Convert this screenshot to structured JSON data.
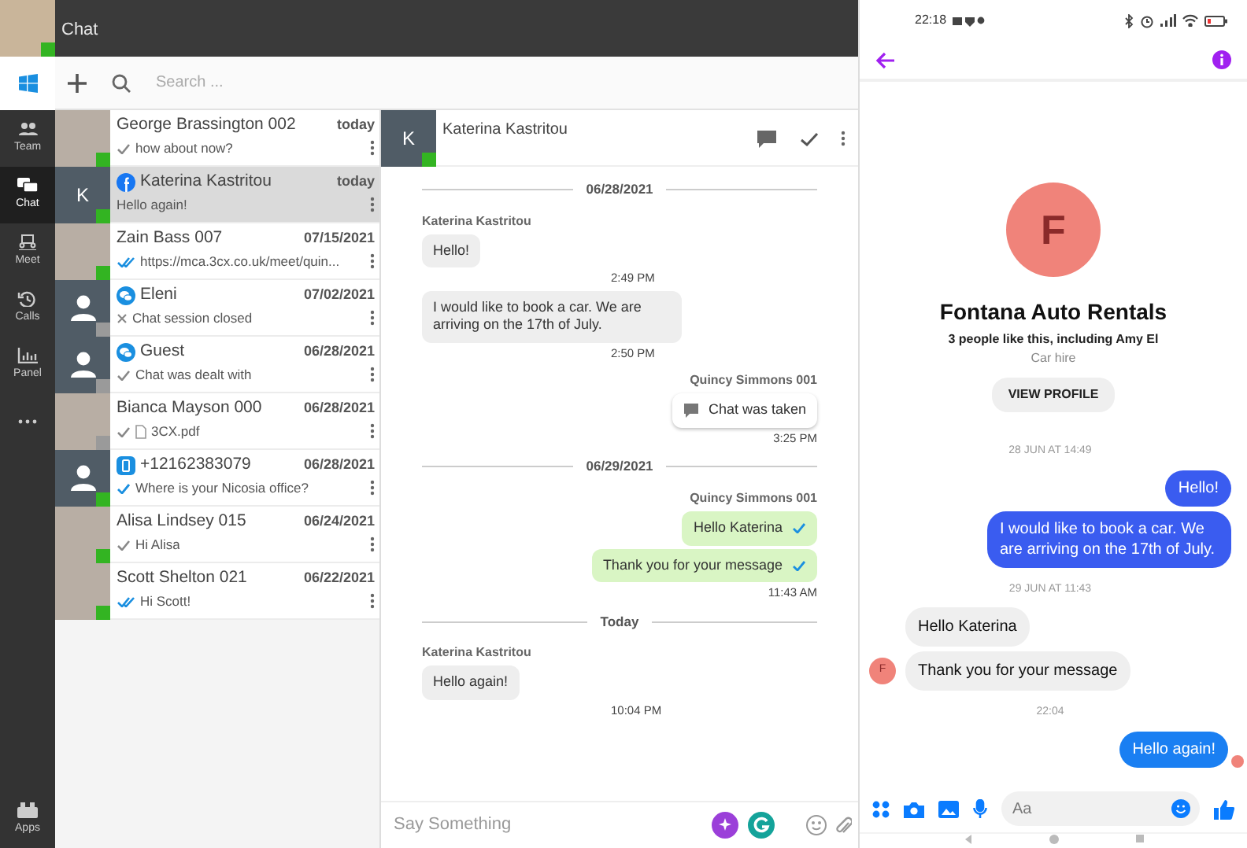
{
  "app": {
    "title": "Chat",
    "search": {
      "placeholder": "Search ..."
    },
    "user_presence": {
      "color": "#33b422"
    }
  },
  "rail": [
    {
      "label": "Team",
      "kind": "team",
      "selected": false
    },
    {
      "label": "Chat",
      "kind": "chat",
      "selected": true
    },
    {
      "label": "Meet",
      "kind": "meet",
      "selected": false
    },
    {
      "label": "Calls",
      "kind": "calls",
      "selected": false
    },
    {
      "label": "Panel",
      "kind": "panel",
      "selected": false
    },
    {
      "kind": "more",
      "selected": false
    }
  ],
  "rail_bottom": {
    "label": "Apps"
  },
  "contacts": [
    {
      "name": "George Brassington 002",
      "time": "today",
      "preview": "how about now?",
      "avatar": {
        "kind": "photo"
      },
      "tick": {
        "kind": "check"
      },
      "attachment": false,
      "color": "#33b422",
      "selected": false
    },
    {
      "name": "Katerina Kastritou",
      "time": "today",
      "preview": "Hello again!",
      "avatar": {
        "kind": "letter",
        "initial": "K"
      },
      "channel": {
        "kind": "facebook"
      },
      "attachment": false,
      "color": "#33b422",
      "selected": true
    },
    {
      "name": "Zain Bass 007",
      "time": "07/15/2021",
      "preview": "https://mca.3cx.co.uk/meet/quin...",
      "avatar": {
        "kind": "photo"
      },
      "tick": {
        "kind": "double"
      },
      "attachment": false,
      "color": "#33b422",
      "selected": false
    },
    {
      "name": "Eleni",
      "time": "07/02/2021",
      "preview": "Chat session closed",
      "avatar": {
        "kind": "silhouette"
      },
      "channel": {
        "kind": "webchat"
      },
      "tick": {
        "kind": "cross"
      },
      "attachment": false,
      "color": "#9a9a9a",
      "selected": false
    },
    {
      "name": "Guest",
      "time": "06/28/2021",
      "preview": "Chat was dealt with",
      "avatar": {
        "kind": "silhouette"
      },
      "channel": {
        "kind": "webchat"
      },
      "tick": {
        "kind": "check"
      },
      "attachment": false,
      "color": "#9a9a9a",
      "selected": false
    },
    {
      "name": "Bianca Mayson 000",
      "time": "06/28/2021",
      "preview": "3CX.pdf",
      "avatar": {
        "kind": "photo"
      },
      "tick": {
        "kind": "check"
      },
      "attachment": true,
      "color": "#9a9a9a",
      "selected": false
    },
    {
      "name": "+12162383079",
      "time": "06/28/2021",
      "preview": "Where is your Nicosia office?",
      "avatar": {
        "kind": "silhouette"
      },
      "channel": {
        "kind": "phone"
      },
      "tick": {
        "kind": "check-blue"
      },
      "attachment": false,
      "color": "#33b422",
      "selected": false
    },
    {
      "name": "Alisa Lindsey 015",
      "time": "06/24/2021",
      "preview": "Hi Alisa",
      "avatar": {
        "kind": "photo"
      },
      "tick": {
        "kind": "check"
      },
      "attachment": false,
      "color": "#33b422",
      "selected": false
    },
    {
      "name": "Scott Shelton 021",
      "time": "06/22/2021",
      "preview": "Hi Scott!",
      "avatar": {
        "kind": "photo"
      },
      "tick": {
        "kind": "double"
      },
      "attachment": false,
      "color": "#33b422",
      "selected": false
    }
  ],
  "conversation": {
    "name": "Katerina Kastritou",
    "initial": "K",
    "presence": {
      "color": "#33b422"
    },
    "messages": [
      {
        "kind": "date",
        "text": "06/28/2021"
      },
      {
        "kind": "in",
        "sender": "Katerina Kastritou",
        "text": "Hello!",
        "time": "2:49 PM"
      },
      {
        "kind": "in",
        "text": "I would like to book a car. We are arriving on the 17th of July.",
        "time": "2:50 PM"
      },
      {
        "kind": "system",
        "sender": "Quincy Simmons 001",
        "text": "Chat was taken",
        "time": "3:25 PM"
      },
      {
        "kind": "date",
        "text": "06/29/2021"
      },
      {
        "kind": "out",
        "sender": "Quincy Simmons 001",
        "text": "Hello Katerina",
        "read": true
      },
      {
        "kind": "out",
        "text": "Thank you for your message",
        "read": true,
        "time": "11:43 AM"
      },
      {
        "kind": "date",
        "text": "Today"
      },
      {
        "kind": "in",
        "sender": "Katerina Kastritou",
        "text": "Hello again!",
        "time": "10:04 PM"
      }
    ],
    "composer": {
      "placeholder": "Say Something"
    }
  },
  "phone": {
    "status_bar": {
      "time": "22:18"
    },
    "profile": {
      "initial": "F",
      "name": "Fontana Auto Rentals",
      "likes": "3 people like this, including Amy El",
      "category": "Car hire",
      "button": "VIEW PROFILE"
    },
    "messages": [
      {
        "kind": "stamp",
        "text": "28 JUN AT 14:49"
      },
      {
        "kind": "out",
        "text": "Hello!"
      },
      {
        "kind": "out",
        "text": "I would like to book a car. We are arriving on the 17th of July."
      },
      {
        "kind": "stamp",
        "text": "29 JUN AT 11:43"
      },
      {
        "kind": "in",
        "text": "Hello Katerina",
        "avatar": false
      },
      {
        "kind": "in",
        "text": "Thank you for your message",
        "avatar": true,
        "initial": "F"
      },
      {
        "kind": "stamp",
        "text": "22:04"
      },
      {
        "kind": "out",
        "text": "Hello again!",
        "seen": true
      }
    ],
    "composer": {
      "placeholder": "Aa"
    }
  }
}
